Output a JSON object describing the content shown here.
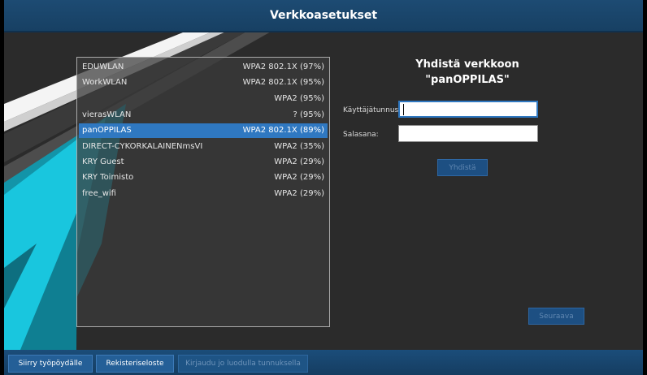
{
  "window": {
    "title": "Verkkoasetukset"
  },
  "networks": [
    {
      "name": "EDUWLAN",
      "security": "WPA2 802.1X (97%)",
      "selected": false
    },
    {
      "name": "WorkWLAN",
      "security": "WPA2 802.1X (95%)",
      "selected": false
    },
    {
      "name": "",
      "security": "WPA2 (95%)",
      "selected": false
    },
    {
      "name": "vierasWLAN",
      "security": "? (95%)",
      "selected": false
    },
    {
      "name": "panOPPILAS",
      "security": "WPA2 802.1X (89%)",
      "selected": true
    },
    {
      "name": "DIRECT-CYKORKALAINENmsVI",
      "security": "WPA2 (35%)",
      "selected": false
    },
    {
      "name": "KRY Guest",
      "security": "WPA2 (29%)",
      "selected": false
    },
    {
      "name": "KRY Toimisto",
      "security": "WPA2 (29%)",
      "selected": false
    },
    {
      "name": "free_wifi",
      "security": "WPA2 (29%)",
      "selected": false
    }
  ],
  "connect": {
    "title_line1": "Yhdistä verkkoon",
    "title_line2": "\"panOPPILAS\"",
    "username_label": "Käyttäjätunnus:",
    "username_value": "",
    "password_label": "Salasana:",
    "password_value": "",
    "connect_button": "Yhdistä",
    "next_button": "Seuraava"
  },
  "bottom_bar": {
    "desktop_button": "Siirry työpöydälle",
    "register_button": "Rekisteriseloste",
    "login_button": "Kirjaudu jo luodulla tunnuksella"
  },
  "colors": {
    "title_bar": "#1d4b73",
    "selection": "#2f78c1",
    "accent_cyan": "#19c6de"
  }
}
